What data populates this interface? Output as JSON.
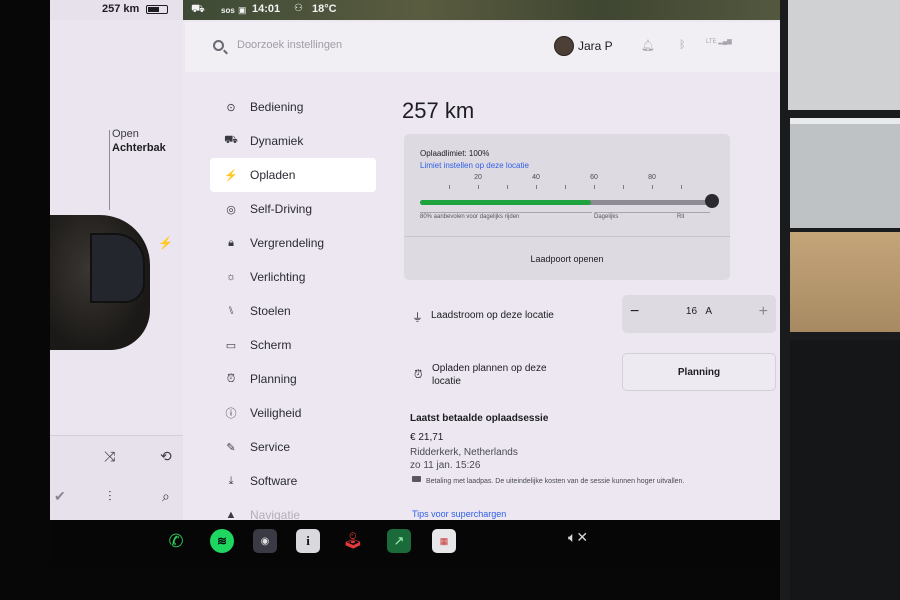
{
  "statusbar": {
    "range": "257 km",
    "battery_level": 0.6,
    "sos": "sos",
    "time": "14:01",
    "temperature": "18°C"
  },
  "car_panel": {
    "trunk_state": "Open",
    "trunk_name": "Achterbak",
    "charging_icon": "bolt-icon",
    "media_icons": [
      "shuffle-icon",
      "repeat-icon",
      "check-circle-icon",
      "equalizer-icon",
      "search-icon"
    ]
  },
  "header": {
    "search_placeholder": "Doorzoek instellingen",
    "user_name": "Jara P",
    "icons": [
      "bell-icon",
      "bluetooth-icon",
      "lte-signal-icon"
    ],
    "lte_label": "LTE"
  },
  "nav": {
    "items": [
      {
        "label": "Bediening",
        "icon": "toggle-icon",
        "glyph": "⊙"
      },
      {
        "label": "Dynamiek",
        "icon": "car-icon",
        "glyph": "⛟"
      },
      {
        "label": "Opladen",
        "icon": "bolt-icon",
        "glyph": "⚡"
      },
      {
        "label": "Self-Driving",
        "icon": "steering-wheel-icon",
        "glyph": "◎"
      },
      {
        "label": "Vergrendeling",
        "icon": "lock-icon",
        "glyph": "🔒︎"
      },
      {
        "label": "Verlichting",
        "icon": "light-icon",
        "glyph": "☼"
      },
      {
        "label": "Stoelen",
        "icon": "seat-icon",
        "glyph": "⑊"
      },
      {
        "label": "Scherm",
        "icon": "screen-icon",
        "glyph": "▭"
      },
      {
        "label": "Planning",
        "icon": "alarm-icon",
        "glyph": "⏰︎"
      },
      {
        "label": "Veiligheid",
        "icon": "safety-icon",
        "glyph": "ⓘ"
      },
      {
        "label": "Service",
        "icon": "wrench-icon",
        "glyph": "✎"
      },
      {
        "label": "Software",
        "icon": "download-icon",
        "glyph": "⤓"
      },
      {
        "label": "Navigatie",
        "icon": "navigation-icon",
        "glyph": "▲"
      }
    ],
    "active_index": 2
  },
  "charging": {
    "range": "257 km",
    "limit_title": "Oplaadlimiet: 100%",
    "limit_link": "Limiet instellen op deze locatie",
    "tick_labels": [
      "20",
      "40",
      "60",
      "80"
    ],
    "current_charge_pct": 59,
    "limit_pct": 100,
    "daily_note": "80% aanbevolen voor dagelijks rijden",
    "zone_daily": "Dagelijks",
    "zone_trip": "Rit",
    "port_button": "Laadpoort openen",
    "current_label": "Laadstroom op deze locatie",
    "current_icon": "plug-icon",
    "current_value": "16",
    "current_unit": "A",
    "minus": "−",
    "plus": "+",
    "schedule_label_1": "Opladen plannen op deze",
    "schedule_label_2": "locatie",
    "schedule_icon": "alarm-icon",
    "schedule_button": "Planning"
  },
  "session": {
    "title": "Laatst betaalde oplaadsessie",
    "amount": "€ 21,71",
    "location": "Ridderkerk, Netherlands",
    "date": "zo 11 jan. 15:26",
    "note": "Betaling met laadpas. De uiteindelijke kosten van de sessie kunnen hoger uitvallen.",
    "tips_link": "Tips voor superchargen"
  },
  "taskbar": {
    "apps": [
      "phone-icon",
      "spotify-icon",
      "camera-icon",
      "info-icon",
      "joystick-icon",
      "chart-icon",
      "calendar-icon"
    ],
    "volume_icon": "volume-muted-icon"
  }
}
